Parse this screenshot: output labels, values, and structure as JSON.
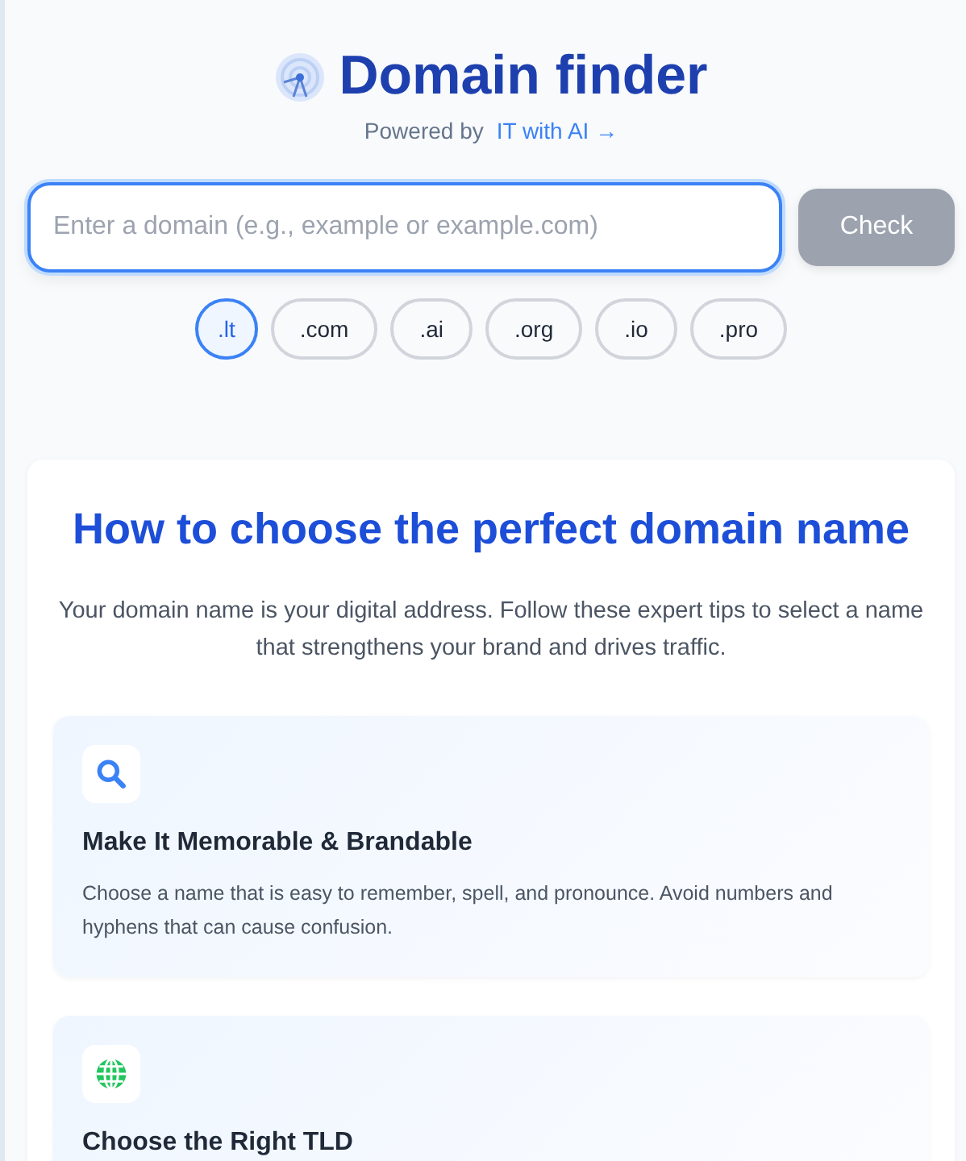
{
  "header": {
    "title": "Domain finder",
    "powered_by": "Powered by",
    "link": "IT with AI →"
  },
  "search": {
    "placeholder": "Enter a domain (e.g., example or example.com)",
    "button": "Check",
    "disabled": true
  },
  "tlds": [
    {
      "label": ".lt",
      "selected": true
    },
    {
      "label": ".com",
      "selected": false
    },
    {
      "label": ".ai",
      "selected": false
    },
    {
      "label": ".org",
      "selected": false
    },
    {
      "label": ".io",
      "selected": false
    },
    {
      "label": ".pro",
      "selected": false
    }
  ],
  "guide": {
    "title": "How to choose the perfect domain name",
    "intro": "Your domain name is your digital address. Follow these expert tips to select a name that strengthens your brand and drives traffic.",
    "tips": [
      {
        "kind": "search",
        "title": "Make It Memorable & Brandable",
        "text": "Choose a name that is easy to remember, spell, and pronounce. Avoid numbers and hyphens that can cause confusion."
      },
      {
        "kind": "globe",
        "title": "Choose the Right TLD"
      }
    ]
  }
}
